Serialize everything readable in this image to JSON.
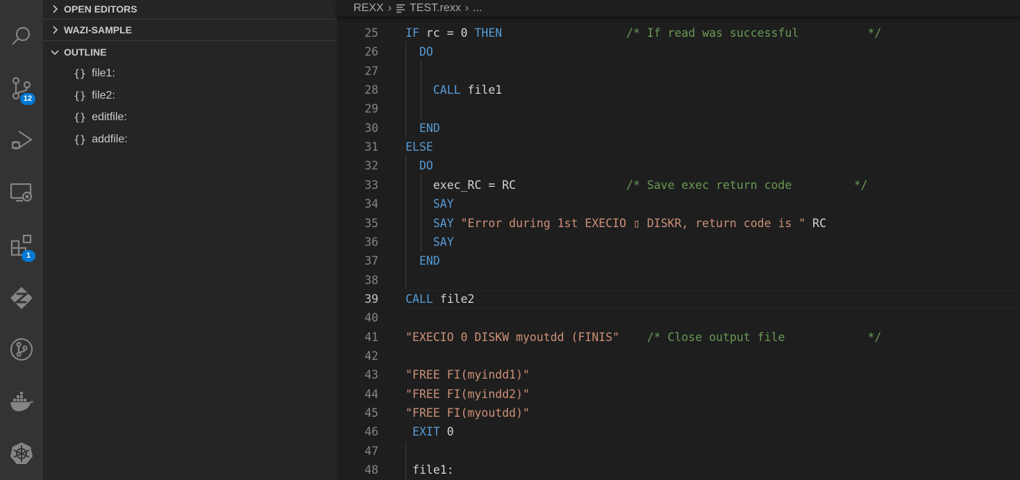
{
  "activity_bar": {
    "items": [
      {
        "icon": "search-icon"
      },
      {
        "icon": "source-control-icon",
        "badge": "12"
      },
      {
        "icon": "run-debug-icon"
      },
      {
        "icon": "remote-explorer-icon"
      },
      {
        "icon": "extensions-icon",
        "badge": "1"
      },
      {
        "icon": "zowe-explorer-icon"
      },
      {
        "icon": "git-graph-icon"
      },
      {
        "icon": "docker-icon"
      },
      {
        "icon": "kubernetes-icon"
      }
    ]
  },
  "sidebar": {
    "sections": [
      {
        "label": "OPEN EDITORS",
        "expanded": false
      },
      {
        "label": "WAZI-SAMPLE",
        "expanded": false
      },
      {
        "label": "OUTLINE",
        "expanded": true
      }
    ],
    "outline_items": [
      "file1:",
      "file2:",
      "editfile:",
      "addfile:"
    ]
  },
  "breadcrumb": {
    "folder": "REXX",
    "file": "TEST.rexx",
    "symbol": "..."
  },
  "editor": {
    "active_line": "39",
    "lines": [
      {
        "n": "25",
        "tokens": [
          [
            "kw",
            "IF"
          ],
          [
            "id",
            " rc = 0 "
          ],
          [
            "kw",
            "THEN"
          ],
          [
            "id",
            "                  "
          ],
          [
            "cm",
            "/* If read was successful          */"
          ]
        ]
      },
      {
        "n": "26",
        "tokens": [
          [
            "id",
            "  "
          ],
          [
            "kw",
            "DO"
          ]
        ]
      },
      {
        "n": "27",
        "tokens": []
      },
      {
        "n": "28",
        "tokens": [
          [
            "id",
            "    "
          ],
          [
            "kw",
            "CALL"
          ],
          [
            "id",
            " file1"
          ]
        ]
      },
      {
        "n": "29",
        "tokens": []
      },
      {
        "n": "30",
        "tokens": [
          [
            "id",
            "  "
          ],
          [
            "kw",
            "END"
          ]
        ]
      },
      {
        "n": "31",
        "tokens": [
          [
            "kw",
            "ELSE"
          ]
        ]
      },
      {
        "n": "32",
        "tokens": [
          [
            "id",
            "  "
          ],
          [
            "kw",
            "DO"
          ]
        ]
      },
      {
        "n": "33",
        "tokens": [
          [
            "id",
            "    exec_RC = RC                "
          ],
          [
            "cm",
            "/* Save exec return code         */"
          ]
        ]
      },
      {
        "n": "34",
        "tokens": [
          [
            "id",
            "    "
          ],
          [
            "kw",
            "SAY"
          ]
        ]
      },
      {
        "n": "35",
        "tokens": [
          [
            "id",
            "    "
          ],
          [
            "kw",
            "SAY"
          ],
          [
            "id",
            " "
          ],
          [
            "str",
            "\"Error during 1st EXECIO ▯ DISKR, return code is \""
          ],
          [
            "id",
            " RC"
          ]
        ]
      },
      {
        "n": "36",
        "tokens": [
          [
            "id",
            "    "
          ],
          [
            "kw",
            "SAY"
          ]
        ]
      },
      {
        "n": "37",
        "tokens": [
          [
            "id",
            "  "
          ],
          [
            "kw",
            "END"
          ]
        ]
      },
      {
        "n": "38",
        "tokens": []
      },
      {
        "n": "39",
        "tokens": [
          [
            "kw",
            "CALL"
          ],
          [
            "id",
            " file2"
          ]
        ]
      },
      {
        "n": "40",
        "tokens": []
      },
      {
        "n": "41",
        "tokens": [
          [
            "str",
            "\"EXECIO 0 DISKW myoutdd (FINIS\""
          ],
          [
            "id",
            "    "
          ],
          [
            "cm",
            "/* Close output file            */"
          ]
        ]
      },
      {
        "n": "42",
        "tokens": []
      },
      {
        "n": "43",
        "tokens": [
          [
            "str",
            "\"FREE FI(myindd1)\""
          ]
        ]
      },
      {
        "n": "44",
        "tokens": [
          [
            "str",
            "\"FREE FI(myindd2)\""
          ]
        ]
      },
      {
        "n": "45",
        "tokens": [
          [
            "str",
            "\"FREE FI(myoutdd)\""
          ]
        ]
      },
      {
        "n": "46",
        "tokens": [
          [
            "id",
            " "
          ],
          [
            "kw",
            "EXIT"
          ],
          [
            "id",
            " 0"
          ]
        ]
      },
      {
        "n": "47",
        "tokens": []
      },
      {
        "n": "48",
        "tokens": [
          [
            "id",
            " file1:"
          ]
        ]
      }
    ]
  },
  "colors": {
    "keyword": "#569cd6",
    "string": "#ce9178",
    "comment": "#6a9955",
    "identifier": "#d4d4d4",
    "badge": "#0078d4"
  }
}
